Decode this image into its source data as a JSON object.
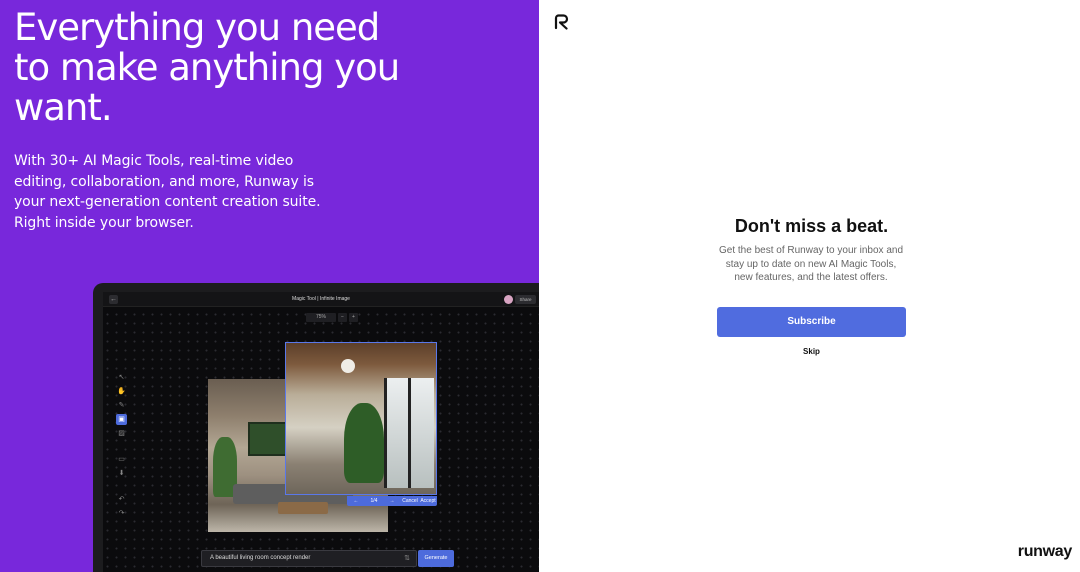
{
  "hero": {
    "headline": "Everything you need to make anything you want.",
    "subtext": "With 30+ AI Magic Tools, real-time video editing, collaboration, and more, Runway is your next-generation content creation suite. Right inside your browser."
  },
  "app_preview": {
    "tool_title": "Magic Tool | Infinite Image",
    "share_label": "Share",
    "zoom_level": "75%",
    "zoom_minus": "−",
    "zoom_plus": "+",
    "back_glyph": "←",
    "tools": [
      "↖",
      "✋",
      "✎",
      "▣",
      "▨",
      "▭",
      "⬇",
      "↶",
      "↷"
    ],
    "actions": {
      "prev": "←",
      "counter": "1/4",
      "next": "→",
      "cancel": "Cancel",
      "accept": "Accept"
    },
    "prompt_value": "A beautiful living room concept render",
    "settings_glyph": "⇅",
    "generate_label": "Generate"
  },
  "modal": {
    "title": "Don't miss a beat.",
    "description": "Get the best of Runway to your inbox and stay up to date on new AI Magic Tools, new features, and the latest offers.",
    "subscribe_label": "Subscribe",
    "skip_label": "Skip"
  },
  "brand": {
    "wordmark": "runway",
    "accent_color": "#506cdf",
    "hero_bg_color": "#7828db"
  }
}
